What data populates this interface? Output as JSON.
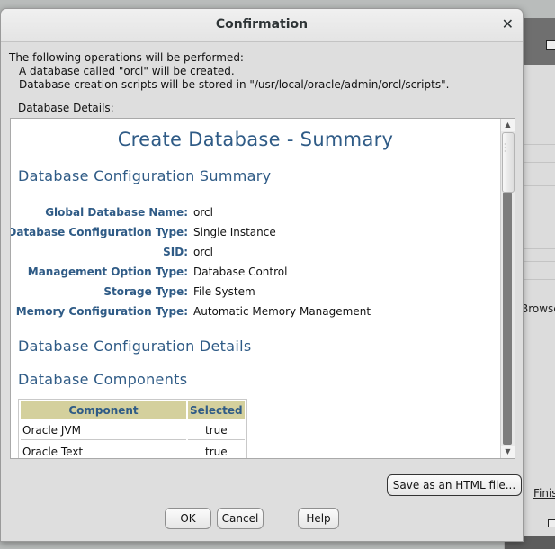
{
  "dialog": {
    "title": "Confirmation",
    "close_glyph": "✕",
    "intro": "The following operations will be performed:",
    "op1": "A database called \"orcl\" will be created.",
    "op2": "Database creation scripts will be stored in \"/usr/local/oracle/admin/orcl/scripts\".",
    "details_label": "Database Details:"
  },
  "report": {
    "title": "Create Database - Summary",
    "config_summary_heading": "Database Configuration Summary",
    "summary_rows": [
      {
        "label": "Global Database Name:",
        "value": "orcl"
      },
      {
        "label": "Database Configuration Type:",
        "value": "Single Instance"
      },
      {
        "label": "SID:",
        "value": "orcl"
      },
      {
        "label": "Management Option Type:",
        "value": "Database Control"
      },
      {
        "label": "Storage Type:",
        "value": "File System"
      },
      {
        "label": "Memory Configuration Type:",
        "value": "Automatic Memory Management"
      }
    ],
    "config_details_heading": "Database Configuration Details",
    "components_heading": "Database Components",
    "components_table": {
      "headers": [
        "Component",
        "Selected"
      ],
      "rows": [
        [
          "Oracle JVM",
          "true"
        ],
        [
          "Oracle Text",
          "true"
        ]
      ]
    }
  },
  "buttons": {
    "save_html": "Save as an HTML file...",
    "ok": "OK",
    "cancel": "Cancel",
    "help": "Help"
  },
  "background_window": {
    "browse_text": "Browse",
    "finish_text": "Finis"
  },
  "scrollbar": {
    "up_glyph": "▲",
    "down_glyph": "▼"
  }
}
